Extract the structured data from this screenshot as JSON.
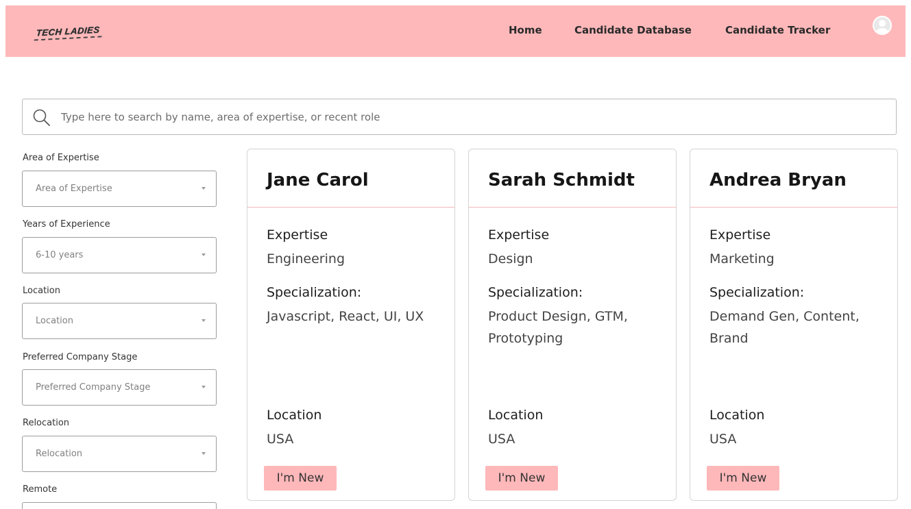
{
  "header": {
    "logo_text": "TECH LADIES",
    "nav": [
      "Home",
      "Candidate Database",
      "Candidate Tracker"
    ]
  },
  "search": {
    "placeholder": "Type here to search by name, area of expertise, or recent role"
  },
  "filters": [
    {
      "label": "Area of Expertise",
      "value": "Area of Expertise"
    },
    {
      "label": "Years of Experience",
      "value": "6-10 years"
    },
    {
      "label": "Location",
      "value": "Location"
    },
    {
      "label": "Preferred Company Stage",
      "value": "Preferred Company Stage"
    },
    {
      "label": "Relocation",
      "value": "Relocation"
    },
    {
      "label": "Remote",
      "value": ""
    }
  ],
  "cards": [
    {
      "name": "Jane Carol",
      "expertise_label": "Expertise",
      "expertise": "Engineering",
      "specialization_label": "Specialization:",
      "specialization": "Javascript, React, UI, UX",
      "location_label": "Location",
      "location": "USA",
      "badge": "I'm New"
    },
    {
      "name": "Sarah Schmidt",
      "expertise_label": "Expertise",
      "expertise": "Design",
      "specialization_label": "Specialization:",
      "specialization": "Product Design, GTM, Prototyping",
      "location_label": "Location",
      "location": "USA",
      "badge": "I'm New"
    },
    {
      "name": "Andrea  Bryan",
      "expertise_label": "Expertise",
      "expertise": "Marketing",
      "specialization_label": "Specialization:",
      "specialization": "Demand Gen, Content, Brand",
      "location_label": "Location",
      "location": "USA",
      "badge": "I'm New"
    }
  ],
  "colors": {
    "brand_pink": "#ffb8ba",
    "divider_pink": "#f3b9bb"
  },
  "icons": {
    "search": "search-icon",
    "avatar": "user-avatar-icon",
    "caret": "chevron-down-icon"
  }
}
